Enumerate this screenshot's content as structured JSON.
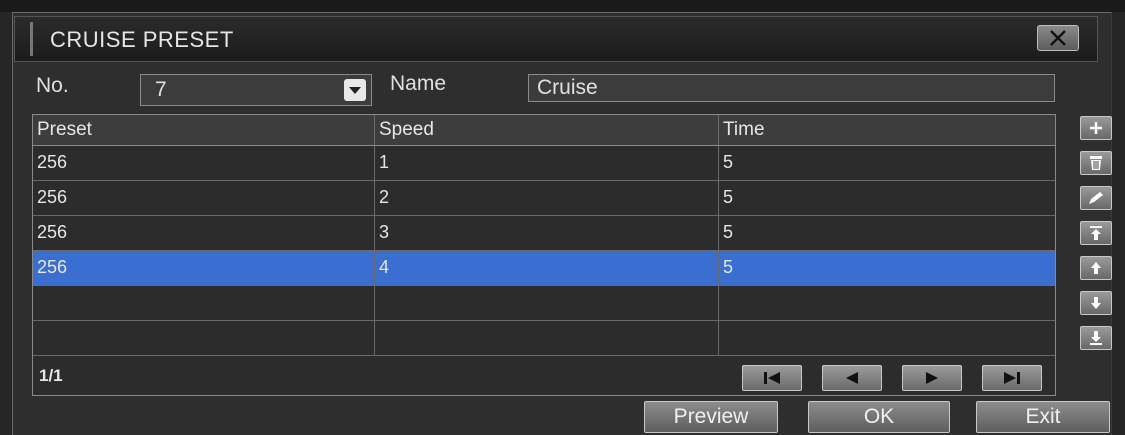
{
  "dialog": {
    "title": "CRUISE PRESET",
    "no_label": "No.",
    "no_value": "7",
    "name_label": "Name",
    "name_value": "Cruise"
  },
  "table": {
    "headers": [
      "Preset",
      "Speed",
      "Time"
    ],
    "rows": [
      {
        "preset": "256",
        "speed": "1",
        "time": "5"
      },
      {
        "preset": "256",
        "speed": "2",
        "time": "5"
      },
      {
        "preset": "256",
        "speed": "3",
        "time": "5"
      },
      {
        "preset": "256",
        "speed": "4",
        "time": "5"
      },
      {
        "preset": "",
        "speed": "",
        "time": ""
      },
      {
        "preset": "",
        "speed": "",
        "time": ""
      }
    ],
    "selected_row_index": 3,
    "page_indicator": "1/1"
  },
  "side_buttons": [
    "plus-icon",
    "trash-icon",
    "edit-icon",
    "move-top-icon",
    "move-up-icon",
    "move-down-icon",
    "move-bottom-icon"
  ],
  "nav_buttons": [
    "first-page-icon",
    "prev-page-icon",
    "next-page-icon",
    "last-page-icon"
  ],
  "buttons": {
    "preview": "Preview",
    "ok": "OK",
    "exit": "Exit"
  },
  "colors": {
    "selection": "#3a6fd1",
    "background": "#2e2e2e"
  }
}
